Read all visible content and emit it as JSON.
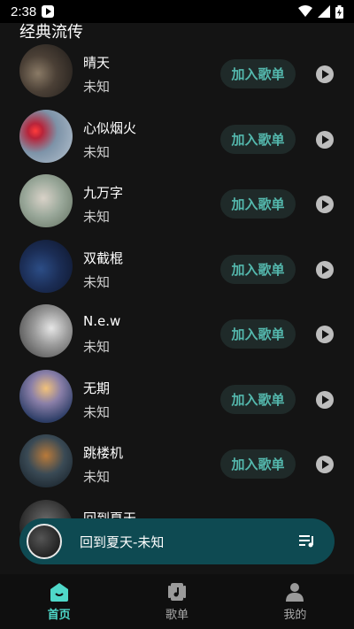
{
  "status": {
    "time": "2:38"
  },
  "section": {
    "title": "经典流传"
  },
  "add_label": "加入歌单",
  "songs": [
    {
      "title": "晴天",
      "artist": "未知"
    },
    {
      "title": "心似烟火",
      "artist": "未知"
    },
    {
      "title": "九万字",
      "artist": "未知"
    },
    {
      "title": "双截棍",
      "artist": "未知"
    },
    {
      "title": "N.e.w",
      "artist": "未知"
    },
    {
      "title": "无期",
      "artist": "未知"
    },
    {
      "title": "跳楼机",
      "artist": "未知"
    },
    {
      "title": "回到夏天",
      "artist": ""
    }
  ],
  "player": {
    "now_playing": "回到夏天-未知"
  },
  "tabs": [
    {
      "label": "首页",
      "icon": "home-icon",
      "active": true
    },
    {
      "label": "歌单",
      "icon": "playlist-icon",
      "active": false
    },
    {
      "label": "我的",
      "icon": "profile-icon",
      "active": false
    }
  ],
  "colors": {
    "accent": "#4fd8c9",
    "player_bg": "#0e4a52",
    "add_text": "#54b8ad"
  }
}
